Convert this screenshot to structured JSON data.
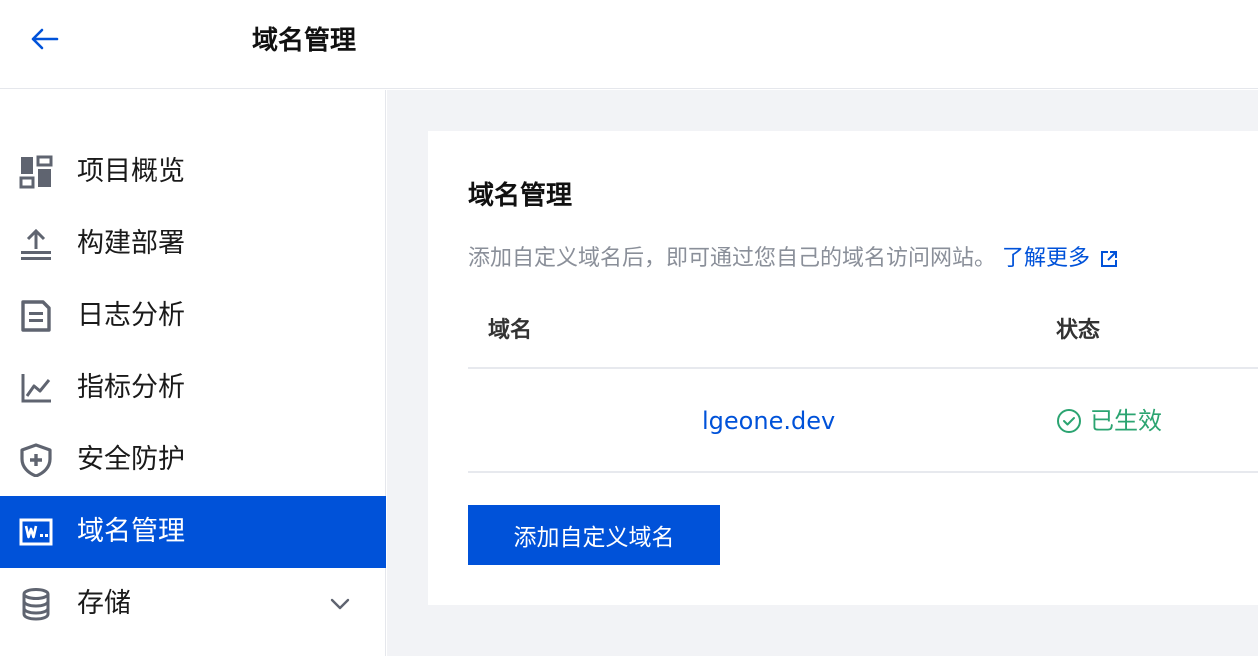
{
  "header": {
    "back_icon": "arrow-left-icon",
    "title": "域名管理"
  },
  "sidebar": {
    "items": [
      {
        "label": "项目概览",
        "icon": "dashboard-icon",
        "active": false
      },
      {
        "label": "构建部署",
        "icon": "upload-icon",
        "active": false
      },
      {
        "label": "日志分析",
        "icon": "document-icon",
        "active": false
      },
      {
        "label": "指标分析",
        "icon": "line-chart-icon",
        "active": false
      },
      {
        "label": "安全防护",
        "icon": "shield-icon",
        "active": false
      },
      {
        "label": "域名管理",
        "icon": "www-icon",
        "active": true
      },
      {
        "label": "存储",
        "icon": "database-icon",
        "active": false,
        "expandable": true
      }
    ]
  },
  "main": {
    "card_title": "域名管理",
    "description": "添加自定义域名后，即可通过您自己的域名访问网站。",
    "learn_more": "了解更多",
    "table": {
      "headers": [
        "域名",
        "状态"
      ],
      "rows": [
        {
          "domain": "lgeone.dev",
          "status": "已生效"
        }
      ]
    },
    "add_button": "添加自定义域名"
  },
  "colors": {
    "primary": "#0052d9",
    "success": "#2ba471",
    "background": "#f2f3f6"
  }
}
